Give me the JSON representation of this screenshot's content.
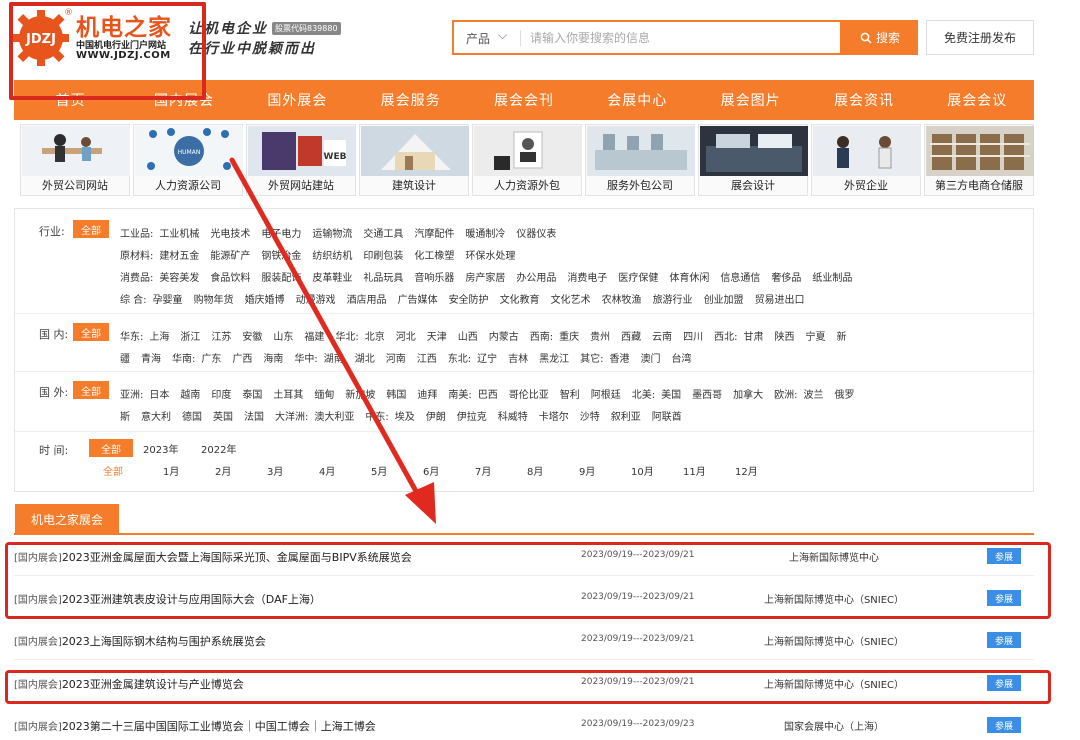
{
  "brand": {
    "name": "机电之家",
    "registered": "®",
    "logo_mark": "JDZJ",
    "tagline_cn": "中国机电行业门户网站",
    "url": "WWW.JDZJ.COM",
    "slogan_line1": "让机电企业",
    "slogan_line2": "在行业中脱颖而出",
    "stock_code": "股票代码839880"
  },
  "search": {
    "category": "产品",
    "placeholder": "请输入你要搜索的信息",
    "button": "搜索"
  },
  "register_button": "免费注册发布",
  "nav": [
    "首页",
    "国内展会",
    "国外展会",
    "展会服务",
    "展会会刊",
    "会展中心",
    "展会图片",
    "展会资讯",
    "展会会议"
  ],
  "tiles": [
    "外贸公司网站",
    "人力资源公司",
    "外贸网站建站",
    "建筑设计",
    "人力资源外包",
    "服务外包公司",
    "展会设计",
    "外贸企业",
    "第三方电商仓储服"
  ],
  "filters": {
    "all_label": "全部",
    "industry": {
      "label": "行业:",
      "lines": [
        [
          "工业品:",
          "工业机械",
          "光电技术",
          "电子电力",
          "运输物流",
          "交通工具",
          "汽摩配件",
          "暖通制冷",
          "仪器仪表"
        ],
        [
          "原材料:",
          "建材五金",
          "能源矿产",
          "钢铁冶金",
          "纺织纺机",
          "印刷包装",
          "化工橡塑",
          "环保水处理"
        ],
        [
          "消费品:",
          "美容美发",
          "食品饮料",
          "服装配饰",
          "皮革鞋业",
          "礼品玩具",
          "音响乐器",
          "房产家居",
          "办公用品",
          "消费电子",
          "医疗保健",
          "体育休闲",
          "信息通信",
          "奢侈品",
          "纸业制品"
        ],
        [
          "综 合:",
          "孕婴童",
          "购物年货",
          "婚庆婚博",
          "动漫游戏",
          "酒店用品",
          "广告媒体",
          "安全防护",
          "文化教育",
          "文化艺术",
          "农林牧渔",
          "旅游行业",
          "创业加盟",
          "贸易进出口"
        ]
      ]
    },
    "domestic": {
      "label": "国 内:",
      "lines": [
        [
          "华东:",
          "上海",
          "浙江",
          "江苏",
          "安徽",
          "山东",
          "福建",
          "华北:",
          "北京",
          "河北",
          "天津",
          "山西",
          "内蒙古",
          "西南:",
          "重庆",
          "贵州",
          "西藏",
          "云南",
          "四川",
          "西北:",
          "甘肃",
          "陕西",
          "宁夏",
          "新"
        ],
        [
          "疆",
          "青海",
          "华南:",
          "广东",
          "广西",
          "海南",
          "华中:",
          "湖南",
          "湖北",
          "河南",
          "江西",
          "东北:",
          "辽宁",
          "吉林",
          "黑龙江",
          "其它:",
          "香港",
          "澳门",
          "台湾"
        ]
      ]
    },
    "foreign": {
      "label": "国 外:",
      "lines": [
        [
          "亚洲:",
          "日本",
          "越南",
          "印度",
          "泰国",
          "土耳其",
          "缅甸",
          "新加坡",
          "韩国",
          "迪拜",
          "南美:",
          "巴西",
          "哥伦比亚",
          "智利",
          "阿根廷",
          "北美:",
          "美国",
          "墨西哥",
          "加拿大",
          "欧洲:",
          "波兰",
          "俄罗"
        ],
        [
          "斯",
          "意大利",
          "德国",
          "英国",
          "法国",
          "大洋洲:",
          "澳大利亚",
          "中东:",
          "埃及",
          "伊朗",
          "伊拉克",
          "科威特",
          "卡塔尔",
          "沙特",
          "叙利亚",
          "阿联酋"
        ]
      ]
    },
    "time": {
      "label": "时 间:",
      "years": [
        "2023年",
        "2022年"
      ],
      "months": [
        "全部",
        "1月",
        "2月",
        "3月",
        "4月",
        "5月",
        "6月",
        "7月",
        "8月",
        "9月",
        "10月",
        "11月",
        "12月"
      ]
    }
  },
  "section_title": "机电之家展会",
  "listings": [
    {
      "tag": "[国内展会]",
      "title": "2023亚洲金属屋面大会暨上海国际采光顶、金属屋面与BIPV系统展览会",
      "date": "2023/09/19---2023/09/21",
      "venue": "上海新国际博览中心",
      "action": "参展"
    },
    {
      "tag": "[国内展会]",
      "title": "2023亚洲建筑表皮设计与应用国际大会（DAF上海）",
      "date": "2023/09/19---2023/09/21",
      "venue": "上海新国际博览中心（SNIEC）",
      "action": "参展"
    },
    {
      "tag": "[国内展会]",
      "title": "2023上海国际钢木结构与围护系统展览会",
      "date": "2023/09/19---2023/09/21",
      "venue": "上海新国际博览中心（SNIEC）",
      "action": "参展"
    },
    {
      "tag": "[国内展会]",
      "title": "2023亚洲金属建筑设计与产业博览会",
      "date": "2023/09/19---2023/09/21",
      "venue": "上海新国际博览中心（SNIEC）",
      "action": "参展"
    },
    {
      "tag": "[国内展会]",
      "title": "2023第二十三届中国国际工业博览会｜中国工博会｜上海工博会",
      "date": "2023/09/19---2023/09/23",
      "venue": "国家会展中心（上海）",
      "action": "参展"
    }
  ],
  "colors": {
    "accent": "#f57c2a",
    "annotation_red": "#d9281e",
    "button_blue": "#3a8ee6"
  }
}
